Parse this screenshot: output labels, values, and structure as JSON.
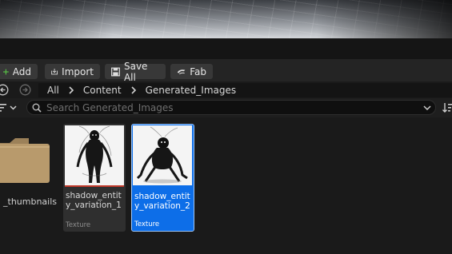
{
  "toolbar": {
    "add_label": "Add",
    "import_label": "Import",
    "save_all_label": "Save All",
    "fab_label": "Fab"
  },
  "breadcrumb": [
    "All",
    "Content",
    "Generated_Images"
  ],
  "search": {
    "placeholder": "Search Generated_Images"
  },
  "folders": [
    {
      "label": "_thumbnails"
    }
  ],
  "assets": [
    {
      "name": "shadow_entity_variation_1",
      "type": "Texture",
      "selected": false
    },
    {
      "name": "shadow_entity_variation_2",
      "type": "Texture",
      "selected": true
    }
  ],
  "colors": {
    "accent": "#0d6ee8",
    "add_icon": "#58c447",
    "folder": "#b89a6c"
  }
}
